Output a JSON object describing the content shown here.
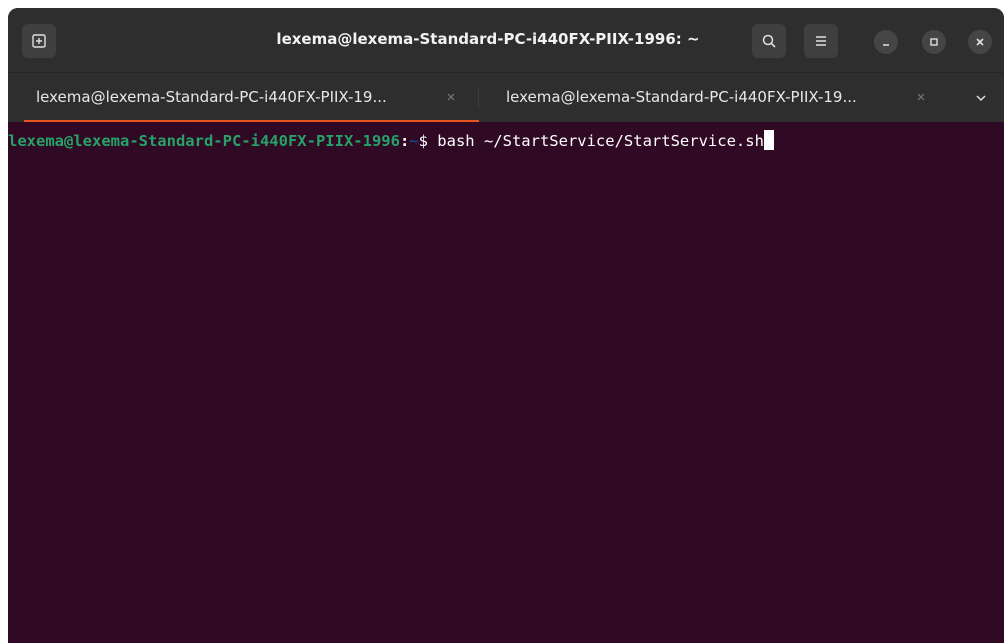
{
  "window": {
    "title": "lexema@lexema-Standard-PC-i440FX-PIIX-1996: ~"
  },
  "header_buttons": {
    "new_tab_icon": "new-tab-icon",
    "search_icon": "search-icon",
    "menu_icon": "hamburger-menu-icon",
    "minimize_icon": "minimize-icon",
    "maximize_icon": "maximize-icon",
    "close_icon": "close-icon"
  },
  "tabs": [
    {
      "label": "lexema@lexema-Standard-PC-i440FX-PIIX-19...",
      "active": true
    },
    {
      "label": "lexema@lexema-Standard-PC-i440FX-PIIX-19...",
      "active": false
    }
  ],
  "terminal": {
    "prompt_user": "lexema@lexema-Standard-PC-i440FX-PIIX-1996",
    "prompt_sep": ":",
    "prompt_path": "~",
    "prompt_symbol": "$ ",
    "command": "bash ~/StartService/StartService.sh"
  },
  "colors": {
    "terminal_bg": "#300a24",
    "header_bg": "#2e2e2e",
    "accent": "#e95420",
    "prompt_user": "#26a269",
    "prompt_path": "#12488b"
  }
}
